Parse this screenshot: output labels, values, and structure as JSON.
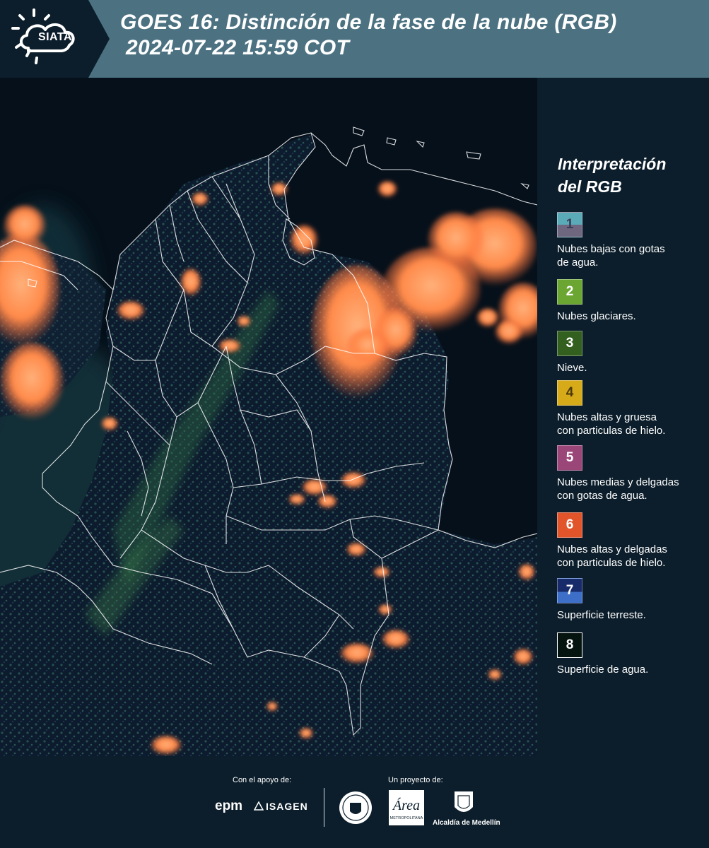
{
  "header": {
    "logo_text": "SIATA",
    "title_line1": "GOES 16: Distinción de la fase de la nube (RGB)",
    "title_line2": "2024-07-22 15:59 COT"
  },
  "legend": {
    "title_line1": "Interpretación",
    "title_line2": "del RGB",
    "items": [
      {
        "number": "1",
        "label_line1": "Nubes bajas con gotas",
        "label_line2": "de agua.",
        "color_top": "#5aaab8",
        "color_bottom": "#6f6680"
      },
      {
        "number": "2",
        "label_line1": "Nubes glaciares.",
        "label_line2": "",
        "color_top": "#6aa631",
        "color_bottom": "#6aa631"
      },
      {
        "number": "3",
        "label_line1": "Nieve.",
        "label_line2": "",
        "color_top": "#335f1f",
        "color_bottom": "#335f1f"
      },
      {
        "number": "4",
        "label_line1": "Nubes altas y gruesa",
        "label_line2": "con particulas de hielo.",
        "color_top": "#d6aa18",
        "color_bottom": "#d6aa18"
      },
      {
        "number": "5",
        "label_line1": "Nubes medias y delgadas",
        "label_line2": "con gotas de agua.",
        "color_top": "#9b4678",
        "color_bottom": "#9b4678"
      },
      {
        "number": "6",
        "label_line1": "Nubes altas y delgadas",
        "label_line2": "con particulas de hielo.",
        "color_top": "#e2552b",
        "color_bottom": "#e2552b"
      },
      {
        "number": "7",
        "label_line1": "Superficie terreste.",
        "label_line2": "",
        "color_top": "#172a6a",
        "color_bottom": "#3d6fc8"
      },
      {
        "number": "8",
        "label_line1": "Superficie de agua.",
        "label_line2": "",
        "color_top": "#06140f",
        "color_bottom": "#06140f"
      }
    ]
  },
  "footer": {
    "support_label": "Con el apoyo de:",
    "project_label": "Un proyecto de:",
    "epm_text": "epm",
    "isagen_text": "ISAGEN",
    "area_text": "Área",
    "area_subtext": "METROPOLITANA",
    "alcaldia_text": "Alcaldía de Medellín"
  },
  "colors": {
    "header_bg": "#4c7282",
    "page_bg": "#0c1e2b",
    "cloud_orange": "#ff8d4f",
    "border_white": "#ffffff"
  }
}
